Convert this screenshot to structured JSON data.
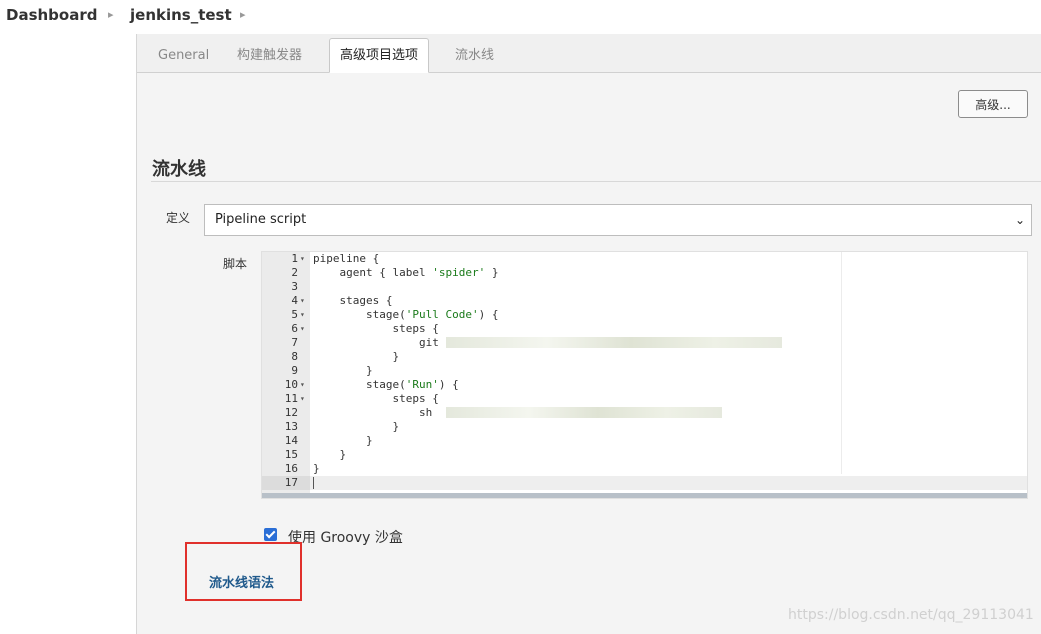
{
  "breadcrumb": {
    "items": [
      "Dashboard",
      "jenkins_test"
    ]
  },
  "tabs": [
    {
      "label": "General",
      "active": false
    },
    {
      "label": "构建触发器",
      "active": false
    },
    {
      "label": "高级项目选项",
      "active": true
    },
    {
      "label": "流水线",
      "active": false
    }
  ],
  "advanced_button": "高级...",
  "section": {
    "title": "流水线"
  },
  "definition": {
    "label": "定义",
    "value": "Pipeline script"
  },
  "script": {
    "label": "脚本",
    "lines": [
      {
        "n": "1",
        "fold": true
      },
      {
        "n": "2",
        "fold": false
      },
      {
        "n": "3",
        "fold": false
      },
      {
        "n": "4",
        "fold": true
      },
      {
        "n": "5",
        "fold": true
      },
      {
        "n": "6",
        "fold": true
      },
      {
        "n": "7",
        "fold": false
      },
      {
        "n": "8",
        "fold": false
      },
      {
        "n": "9",
        "fold": false
      },
      {
        "n": "10",
        "fold": true
      },
      {
        "n": "11",
        "fold": true
      },
      {
        "n": "12",
        "fold": false
      },
      {
        "n": "13",
        "fold": false
      },
      {
        "n": "14",
        "fold": false
      },
      {
        "n": "15",
        "fold": false
      },
      {
        "n": "16",
        "fold": false
      },
      {
        "n": "17",
        "fold": false
      }
    ],
    "code": {
      "l1": "pipeline {",
      "l2a": "    agent { label ",
      "l2s": "'spider'",
      "l2b": " }",
      "l4": "    stages {",
      "l5a": "        stage(",
      "l5s": "'Pull Code'",
      "l5b": ") {",
      "l6": "            steps {",
      "l7": "                git",
      "l8": "            }",
      "l9": "        }",
      "l10a": "        stage(",
      "l10s": "'Run'",
      "l10b": ") {",
      "l11": "            steps {",
      "l12": "                sh",
      "l13": "            }",
      "l14": "        }",
      "l15": "    }",
      "l16": "}"
    }
  },
  "groovy_sandbox": {
    "label": "使用 Groovy 沙盒",
    "checked": true
  },
  "syntax_link": "流水线语法",
  "watermark": "https://blog.csdn.net/qq_29113041"
}
